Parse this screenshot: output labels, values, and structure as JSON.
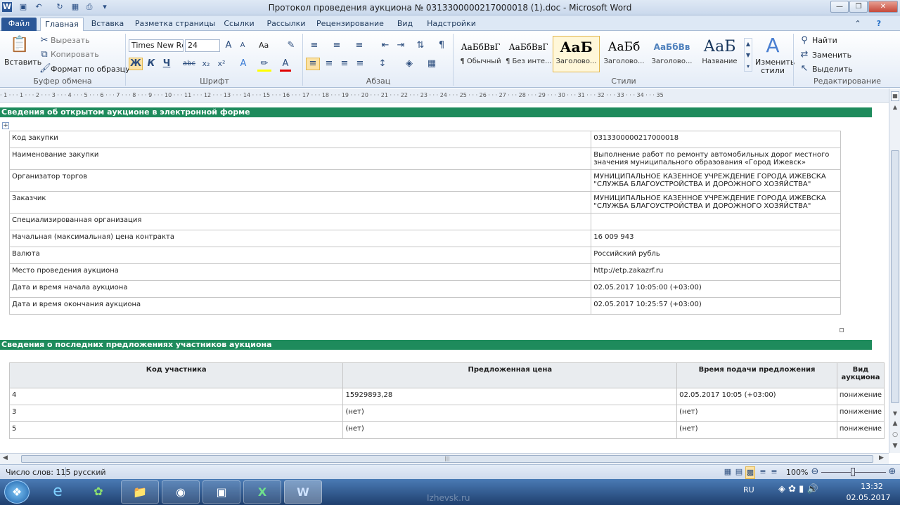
{
  "window": {
    "title": "Протокол проведения аукциона № 0313300000217000018 (1).doc - Microsoft Word",
    "app_icon": "W"
  },
  "tabs": [
    "Файл",
    "Главная",
    "Вставка",
    "Разметка страницы",
    "Ссылки",
    "Рассылки",
    "Рецензирование",
    "Вид",
    "Надстройки"
  ],
  "ribbon": {
    "clipboard": {
      "paste": "Вставить",
      "cut": "Вырезать",
      "copy": "Копировать",
      "format_painter": "Формат по образцу",
      "label": "Буфер обмена"
    },
    "font": {
      "name": "Times New Rc",
      "size": "24",
      "bold": "Ж",
      "italic": "К",
      "underline": "Ч",
      "strike": "abc",
      "sub": "x₂",
      "sup": "x²",
      "case": "Aa",
      "label": "Шрифт"
    },
    "paragraph": {
      "label": "Абзац"
    },
    "styles": {
      "items": [
        {
          "sample": "АаБбВвГ",
          "name": "¶ Обычный"
        },
        {
          "sample": "АаБбВвГ",
          "name": "¶ Без инте..."
        },
        {
          "sample": "АаБ",
          "name": "Заголово..."
        },
        {
          "sample": "АаБб",
          "name": "Заголово..."
        },
        {
          "sample": "АаБбВв",
          "name": "Заголово..."
        },
        {
          "sample": "АаБ",
          "name": "Название"
        }
      ],
      "change": "Изменить стили",
      "label": "Стили"
    },
    "editing": {
      "find": "Найти",
      "replace": "Заменить",
      "select": "Выделить",
      "label": "Редактирование"
    }
  },
  "ruler_text": "· 1 · · · 1 · · · 2 · · · 3 · · · 4 · · · 5 · · · 6 · · · 7 · · · 8 · · · 9 · · · 10 · · · 11 · · · 12 · · · 13 · · · 14 · · · 15 · · · 16 · · · 17 · · · 18 · · · 19 · · · 20 · · · 21 · · · 22 · · · 23 · · · 24 · · · 25 · · · 26 · · · 27 · · · 28 · · · 29 · · · 30 · · · 31 · · · 32 · · · 33 · · · 34 · · · 35",
  "document": {
    "section1_title": "Сведения об открытом аукционе в электронной форме",
    "auction_info": [
      {
        "label": "Код закупки",
        "value": "0313300000217000018"
      },
      {
        "label": "Наименование закупки",
        "value": "Выполнение работ по ремонту автомобильных дорог местного значения муниципального образования «Город Ижевск»"
      },
      {
        "label": "Организатор торгов",
        "value": "МУНИЦИПАЛЬНОЕ КАЗЕННОЕ УЧРЕЖДЕНИЕ ГОРОДА ИЖЕВСКА \"СЛУЖБА БЛАГОУСТРОЙСТВА И ДОРОЖНОГО ХОЗЯЙСТВА\""
      },
      {
        "label": "Заказчик",
        "value": "МУНИЦИПАЛЬНОЕ КАЗЕННОЕ УЧРЕЖДЕНИЕ ГОРОДА ИЖЕВСКА \"СЛУЖБА БЛАГОУСТРОЙСТВА И ДОРОЖНОГО ХОЗЯЙСТВА\""
      },
      {
        "label": "Специализированная организация",
        "value": ""
      },
      {
        "label": "Начальная (максимальная) цена контракта",
        "value": "16 009 943"
      },
      {
        "label": "Валюта",
        "value": "Российский рубль"
      },
      {
        "label": "Место проведения аукциона",
        "value": "http://etp.zakazrf.ru"
      },
      {
        "label": "Дата и время начала аукциона",
        "value": "02.05.2017 10:05:00 (+03:00)"
      },
      {
        "label": "Дата и время окончания аукциона",
        "value": "02.05.2017 10:25:57 (+03:00)"
      }
    ],
    "section2_title": "Сведения о последних предложениях участников аукциона",
    "offers_headers": [
      "Код участника",
      "Предложенная цена",
      "Время подачи предложения",
      "Вид аукциона"
    ],
    "offers": [
      [
        "4",
        "15929893,28",
        "02.05.2017 10:05 (+03:00)",
        "понижение"
      ],
      [
        "3",
        "(нет)",
        "(нет)",
        "понижение"
      ],
      [
        "5",
        "(нет)",
        "(нет)",
        "понижение"
      ]
    ]
  },
  "status": {
    "words": "Число слов: 115",
    "language": "русский",
    "zoom": "100%"
  },
  "taskbar": {
    "lang": "RU",
    "time": "13:32",
    "date": "02.05.2017",
    "watermark": "Izhevsk.ru"
  }
}
